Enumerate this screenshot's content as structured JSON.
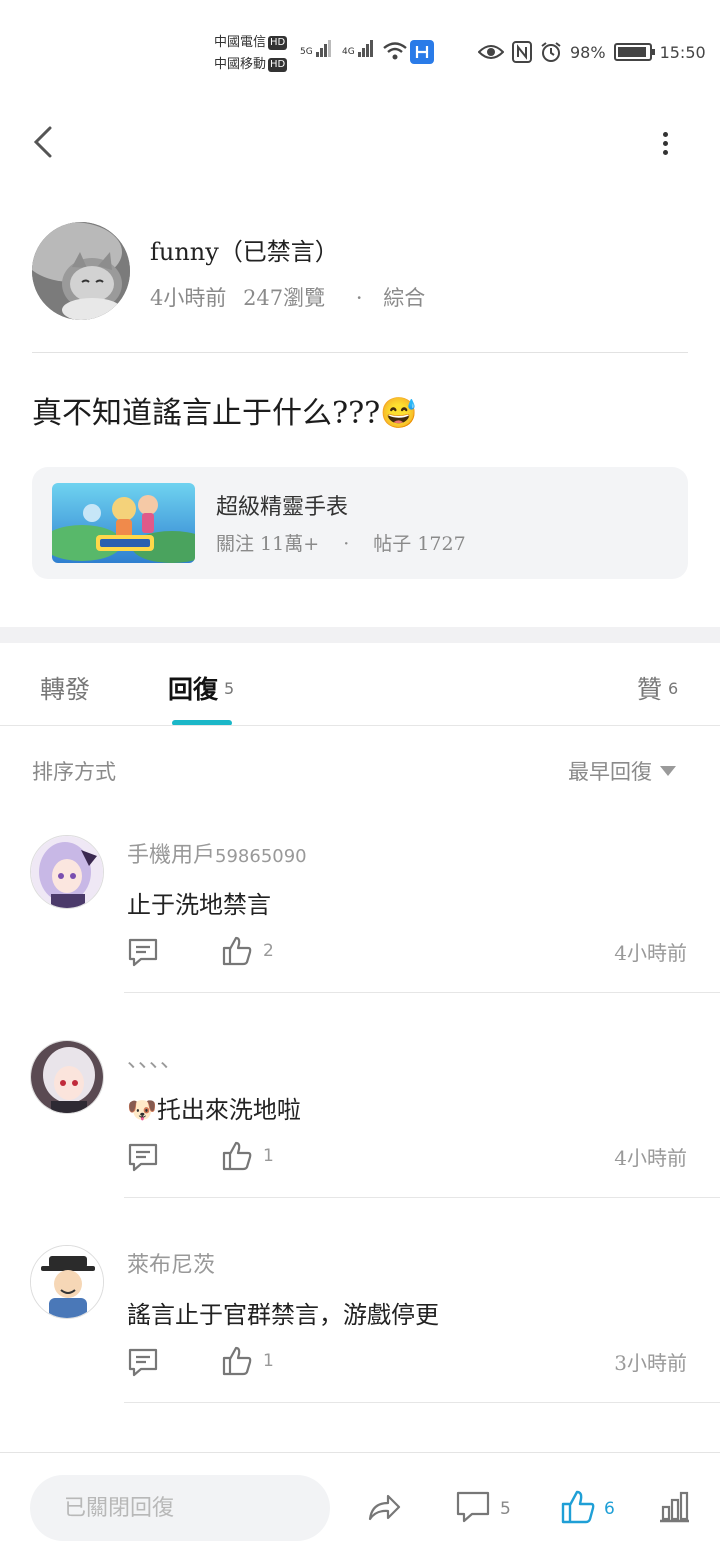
{
  "status_bar": {
    "carrier1": "中國電信",
    "carrier2": "中國移動",
    "hd": "HD",
    "net1": "5G",
    "net2": "4G",
    "battery": "98%",
    "time": "15:50"
  },
  "post": {
    "author": "funny（已禁言）",
    "time_ago": "4小時前",
    "views": "247瀏覽",
    "dot": "·",
    "category": "綜合",
    "body": "真不知道謠言止于什么???😅"
  },
  "game_card": {
    "name": "超級精靈手表",
    "followers": "關注 11萬+",
    "dot": "·",
    "posts": "帖子 1727"
  },
  "tabs": {
    "forward": "轉發",
    "reply": "回復",
    "reply_count": "5",
    "likes": "贊",
    "likes_count": "6"
  },
  "sort": {
    "label": "排序方式",
    "selected": "最早回復"
  },
  "comments": [
    {
      "user": "手機用戶",
      "user_num": "59865090",
      "text": "止于洗地禁言",
      "likes": "2",
      "time": "4小時前"
    },
    {
      "user": "、、、、",
      "user_num": "",
      "text": "🐶托出來洗地啦",
      "likes": "1",
      "time": "4小時前"
    },
    {
      "user": "萊布尼茨",
      "user_num": "",
      "text": "謠言止于官群禁言，游戲停更",
      "likes": "1",
      "time": "3小時前"
    }
  ],
  "bottom_bar": {
    "placeholder": "已關閉回復",
    "comment_count": "5",
    "like_count": "6"
  },
  "colors": {
    "accent": "#1bb7c8",
    "like_active": "#1f9fd6"
  }
}
